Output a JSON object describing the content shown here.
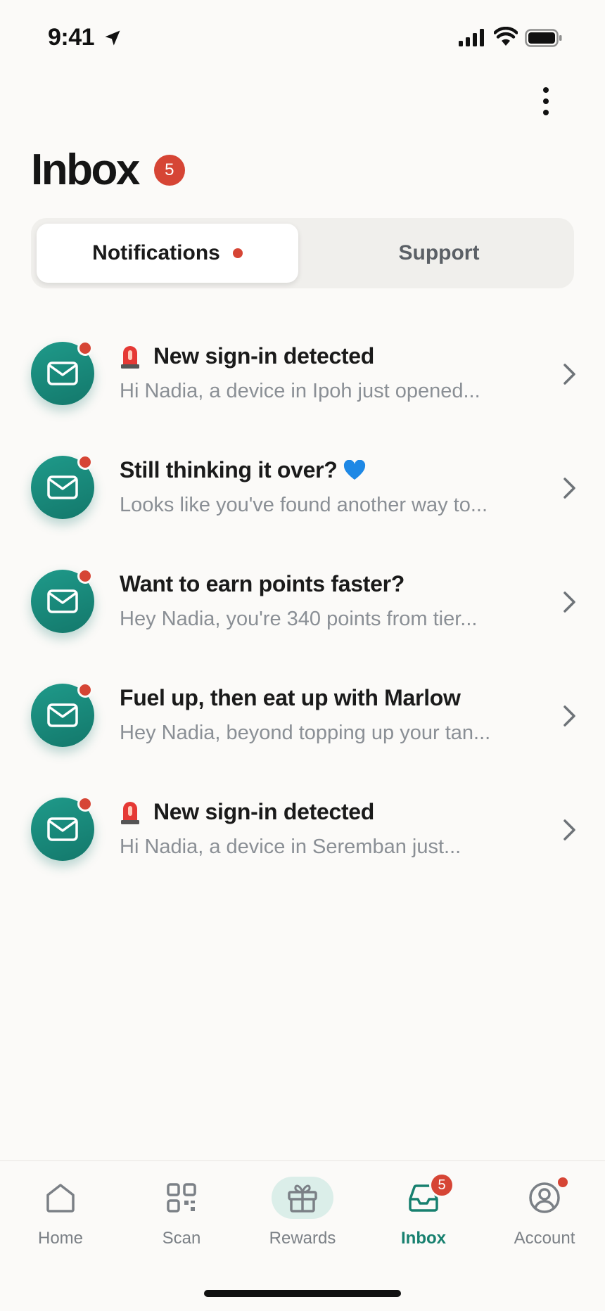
{
  "status_bar": {
    "time": "9:41"
  },
  "header": {
    "title": "Inbox",
    "unread_count": "5"
  },
  "tabs": {
    "notifications_label": "Notifications",
    "support_label": "Support",
    "selected": "Notifications"
  },
  "notifications": [
    {
      "title": "New sign-in detected",
      "preview": "Hi Nadia, a device in Ipoh just opened...",
      "emoji": "siren",
      "unread": true
    },
    {
      "title": "Still thinking it over?",
      "preview": "Looks like you've found another way to...",
      "emoji": "blue-heart",
      "unread": true
    },
    {
      "title": "Want to earn points faster?",
      "preview": "Hey Nadia, you're 340 points from tier...",
      "emoji": "",
      "unread": true
    },
    {
      "title": "Fuel up, then eat up with Marlow",
      "preview": "Hey Nadia, beyond topping up your tan...",
      "emoji": "",
      "unread": true
    },
    {
      "title": "New sign-in detected",
      "preview": "Hi Nadia, a device in Seremban just...",
      "emoji": "siren",
      "unread": true
    }
  ],
  "bottom_nav": {
    "items": [
      {
        "label": "Home",
        "icon": "home-icon"
      },
      {
        "label": "Scan",
        "icon": "scan-icon"
      },
      {
        "label": "Rewards",
        "icon": "gift-icon"
      },
      {
        "label": "Inbox",
        "icon": "inbox-icon",
        "badge": "5",
        "active": true
      },
      {
        "label": "Account",
        "icon": "account-icon",
        "dot": true
      }
    ]
  },
  "colors": {
    "accent": "#17806f",
    "badge": "#d64535",
    "background": "#fbfaf8",
    "avatar": "#1a8b7c"
  }
}
